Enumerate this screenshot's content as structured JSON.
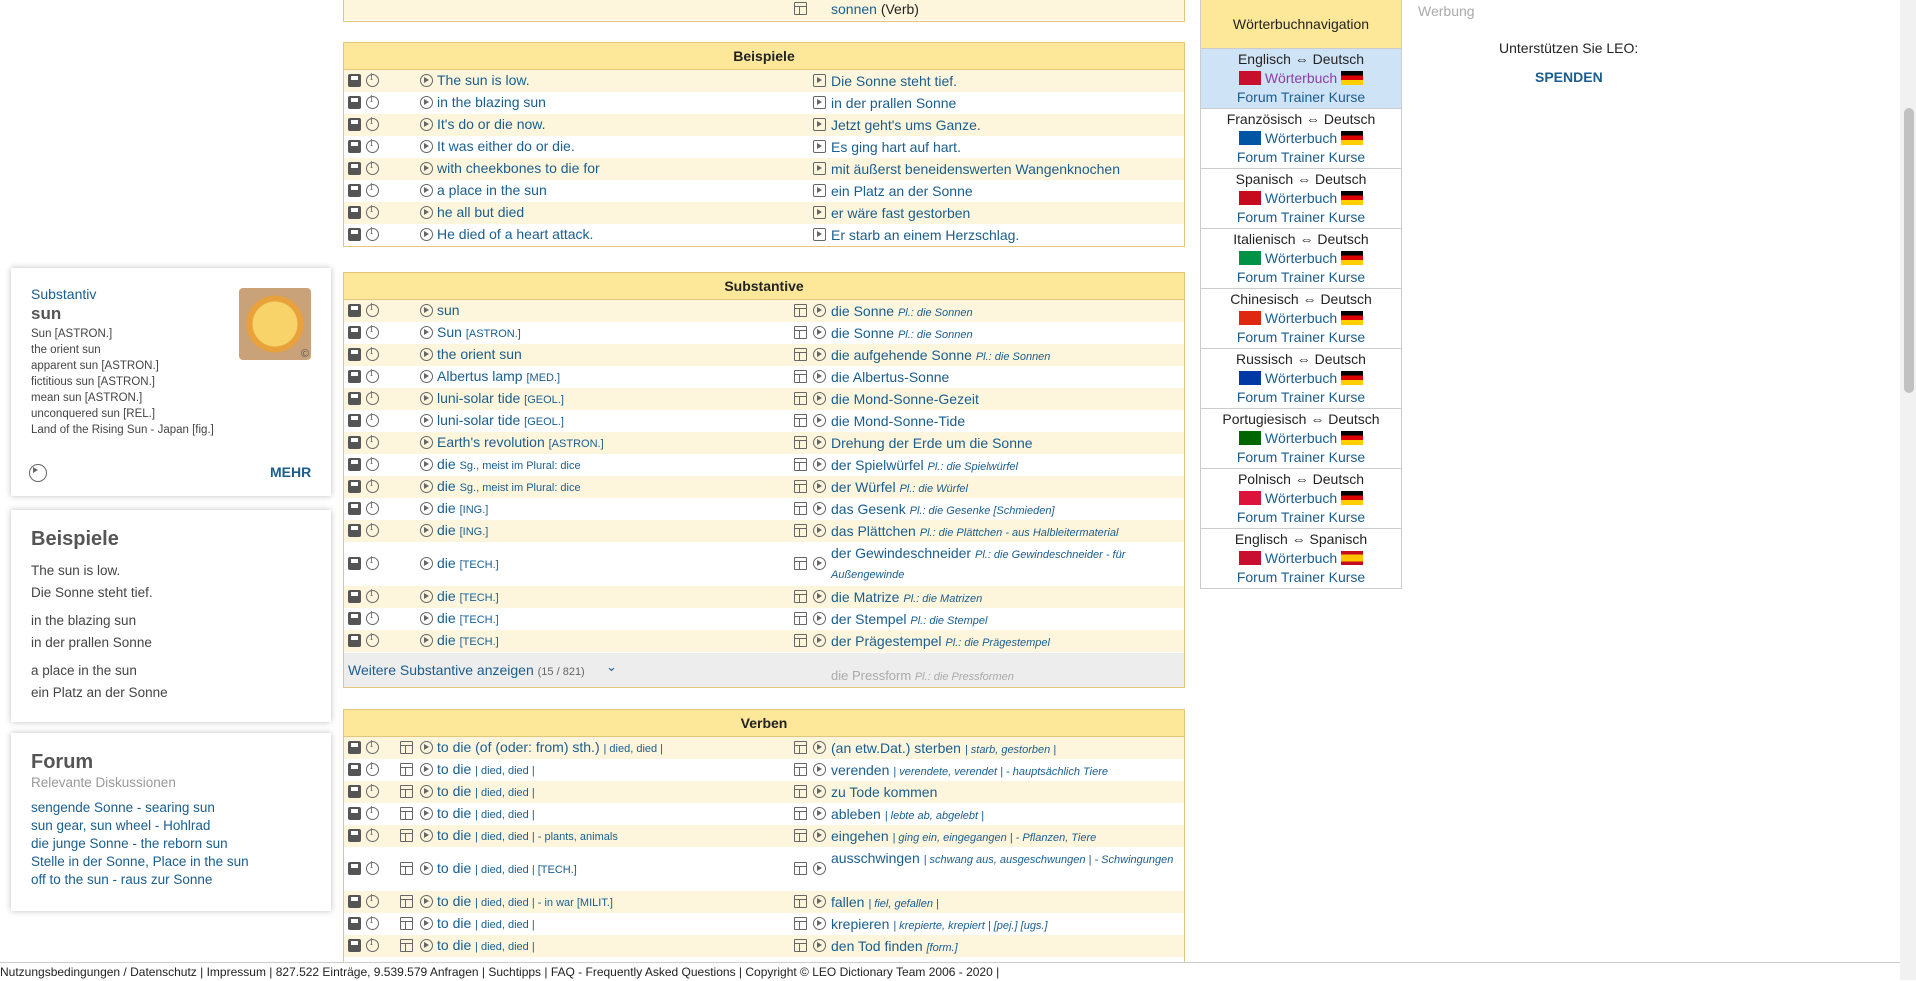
{
  "top_row": {
    "de": "sonnen",
    "de_suffix": "(Verb)"
  },
  "beispiele": {
    "header": "Beispiele",
    "rows": [
      {
        "en": "The sun is low.",
        "de": "Die Sonne steht tief."
      },
      {
        "en": "in the blazing sun",
        "de": "in der prallen Sonne"
      },
      {
        "en": "It's do or die now.",
        "de": "Jetzt geht's ums Ganze."
      },
      {
        "en": "It was either do or die.",
        "de": "Es ging hart auf hart."
      },
      {
        "en": "with cheekbones to die for",
        "de": "mit äußerst beneidenswerten Wangenknochen"
      },
      {
        "en": "a place in the sun",
        "de": "ein Platz an der Sonne"
      },
      {
        "en": "he all but died",
        "de": "er wäre fast gestorben"
      },
      {
        "en": "He died of a heart attack.",
        "de": "Er starb an einem Herzschlag."
      }
    ]
  },
  "substantive": {
    "header": "Substantive",
    "rows": [
      {
        "en": "sun",
        "de": "die Sonne",
        "de_note": "Pl.: die Sonnen"
      },
      {
        "en": "Sun",
        "en_note": "[ASTRON.]",
        "de": "die Sonne",
        "de_note": "Pl.: die Sonnen"
      },
      {
        "en": "the orient sun",
        "de": "die aufgehende Sonne",
        "de_note": "Pl.: die Sonnen"
      },
      {
        "en": "Albertus lamp",
        "en_note": "[MED.]",
        "de": "die Albertus-Sonne"
      },
      {
        "en": "luni-solar tide",
        "en_note": "[GEOL.]",
        "de": "die Mond-Sonne-Gezeit"
      },
      {
        "en": "luni-solar tide",
        "en_note": "[GEOL.]",
        "de": "die Mond-Sonne-Tide"
      },
      {
        "en": "Earth's revolution",
        "en_note": "[ASTRON.]",
        "de": "Drehung der Erde um die Sonne"
      },
      {
        "en": "die",
        "en_note": "Sg., meist im Plural: dice",
        "de": "der Spielwürfel",
        "de_note": "Pl.: die Spielwürfel"
      },
      {
        "en": "die",
        "en_note": "Sg., meist im Plural: dice",
        "de": "der Würfel",
        "de_note": "Pl.: die Würfel"
      },
      {
        "en": "die",
        "en_note": "[ING.]",
        "de": "das Gesenk",
        "de_note": "Pl.: die Gesenke    [Schmieden]"
      },
      {
        "en": "die",
        "en_note": "[ING.]",
        "de": "das Plättchen",
        "de_note": "Pl.: die Plättchen  - aus Halbleitermaterial"
      },
      {
        "en": "die",
        "en_note": "[TECH.]",
        "de": "der Gewindeschneider",
        "de_note": "Pl.: die Gewindeschneider  - für Außengewinde"
      },
      {
        "en": "die",
        "en_note": "[TECH.]",
        "de": "die Matrize",
        "de_note": "Pl.: die Matrizen"
      },
      {
        "en": "die",
        "en_note": "[TECH.]",
        "de": "der Stempel",
        "de_note": "Pl.: die Stempel"
      },
      {
        "en": "die",
        "en_note": "[TECH.]",
        "de": "der Prägestempel",
        "de_note": "Pl.: die Prägestempel"
      }
    ],
    "more_label": "Weitere Substantive anzeigen",
    "more_count": "(15 / 821)",
    "fade_de": "die Pressform",
    "fade_note": "Pl.: die Pressformen"
  },
  "verben": {
    "header": "Verben",
    "rows": [
      {
        "en": "to die (of (oder: from) sth.)",
        "en_note": "| died, died |",
        "de": "(an etw.Dat.) sterben",
        "de_note": "| starb, gestorben |"
      },
      {
        "en": "to die",
        "en_note": "| died, died |",
        "de": "verenden",
        "de_note": "| verendete, verendet |  - hauptsächlich Tiere"
      },
      {
        "en": "to die",
        "en_note": "| died, died |",
        "de": "zu Tode kommen"
      },
      {
        "en": "to die",
        "en_note": "| died, died |",
        "de": "ableben",
        "de_note": "| lebte ab, abgelebt |"
      },
      {
        "en": "to die",
        "en_note": "| died, died |  - plants, animals",
        "de": "eingehen",
        "de_note": "| ging ein, eingegangen |  - Pflanzen, Tiere"
      },
      {
        "en": "to die",
        "en_note": "| died, died | [TECH.]",
        "de": "ausschwingen",
        "de_note": "| schwang aus, ausgeschwungen |  - Schwingungen"
      },
      {
        "en": "to die",
        "en_note": "| died, died |  - in war [MILIT.]",
        "de": "fallen",
        "de_note": "| fiel, gefallen |"
      },
      {
        "en": "to die",
        "en_note": "| died, died |",
        "de": "krepieren",
        "de_note": "| krepierte, krepiert | [pej.] [ugs.]"
      },
      {
        "en": "to die",
        "en_note": "| died, died |",
        "de": "den Tod finden",
        "de_note": "[form.]"
      }
    ]
  },
  "wordcard": {
    "type": "Substantiv",
    "word": "sun",
    "lines": [
      "Sun [ASTRON.]",
      "the orient sun",
      "apparent sun [ASTRON.]",
      "fictitious sun [ASTRON.]",
      "mean sun [ASTRON.]",
      "unconquered sun [REL.]",
      "Land of the Rising Sun  - Japan [fig.]"
    ],
    "more": "MEHR",
    "copyright": "©"
  },
  "examples_card": {
    "title": "Beispiele",
    "pairs": [
      [
        "The sun is low.",
        "Die Sonne steht tief."
      ],
      [
        "in the blazing sun",
        "in der prallen Sonne"
      ],
      [
        "a place in the sun",
        "ein Platz an der Sonne"
      ]
    ]
  },
  "forum_card": {
    "title": "Forum",
    "subtitle": "Relevante Diskussionen",
    "links": [
      "sengende Sonne - searing sun",
      "sun gear, sun wheel - Hohlrad",
      "die junge Sonne - the reborn sun",
      "Stelle in der Sonne, Place in the sun",
      "off to the sun - raus zur Sonne"
    ]
  },
  "nav": {
    "header": "Wörterbuchnavigation",
    "items": [
      {
        "pair": "Englisch ⇔ Deutsch",
        "dict": "Wörterbuch",
        "links": "Forum Trainer Kurse"
      },
      {
        "pair": "Französisch ⇔ Deutsch",
        "dict": "Wörterbuch",
        "links": "Forum Trainer Kurse"
      },
      {
        "pair": "Spanisch ⇔ Deutsch",
        "dict": "Wörterbuch",
        "links": "Forum Trainer Kurse"
      },
      {
        "pair": "Italienisch ⇔ Deutsch",
        "dict": "Wörterbuch",
        "links": "Forum Trainer Kurse"
      },
      {
        "pair": "Chinesisch ⇔ Deutsch",
        "dict": "Wörterbuch",
        "links": "Forum Trainer Kurse"
      },
      {
        "pair": "Russisch ⇔ Deutsch",
        "dict": "Wörterbuch",
        "links": "Forum Trainer Kurse"
      },
      {
        "pair": "Portugiesisch ⇔ Deutsch",
        "dict": "Wörterbuch",
        "links": "Forum Trainer Kurse"
      },
      {
        "pair": "Polnisch ⇔ Deutsch",
        "dict": "Wörterbuch",
        "links": "Forum Trainer Kurse"
      },
      {
        "pair": "Englisch ⇔ Spanisch",
        "dict": "Wörterbuch",
        "links": "Forum Trainer Kurse"
      }
    ]
  },
  "ad": {
    "label": "Werbung",
    "support": "Unterstützen Sie LEO:",
    "donate": "SPENDEN"
  },
  "footer": {
    "text": "Nutzungsbedingungen / Datenschutz | Impressum | 827.522 Einträge, 9.539.579 Anfragen | Suchtipps |  FAQ - Frequently Asked Questions | Copyright © LEO Dictionary Team 2006 - 2020 |"
  },
  "colors": {
    "header_bg": "#fde89a",
    "row_alt": "#fdf6dd",
    "link": "#1a5d8f",
    "nav_selected": "#cfe3f7"
  }
}
